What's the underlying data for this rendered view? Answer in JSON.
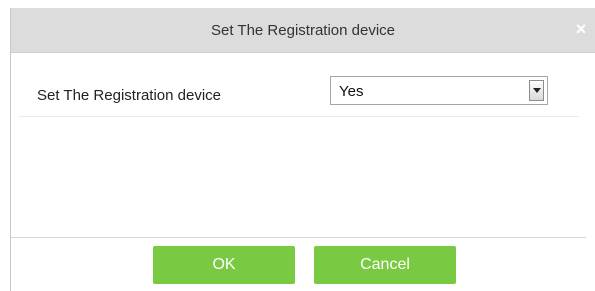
{
  "dialog": {
    "title": "Set The Registration device",
    "close_symbol": "×",
    "close_icon": "close-icon"
  },
  "form": {
    "label": "Set The Registration device",
    "select_value": "Yes",
    "select_arrow_icon": "chevron-down-icon"
  },
  "buttons": {
    "ok_label": "OK",
    "cancel_label": "Cancel"
  },
  "colors": {
    "titlebar": "#dcdcdc",
    "button": "#7ac943",
    "button_text": "#ffffff"
  }
}
